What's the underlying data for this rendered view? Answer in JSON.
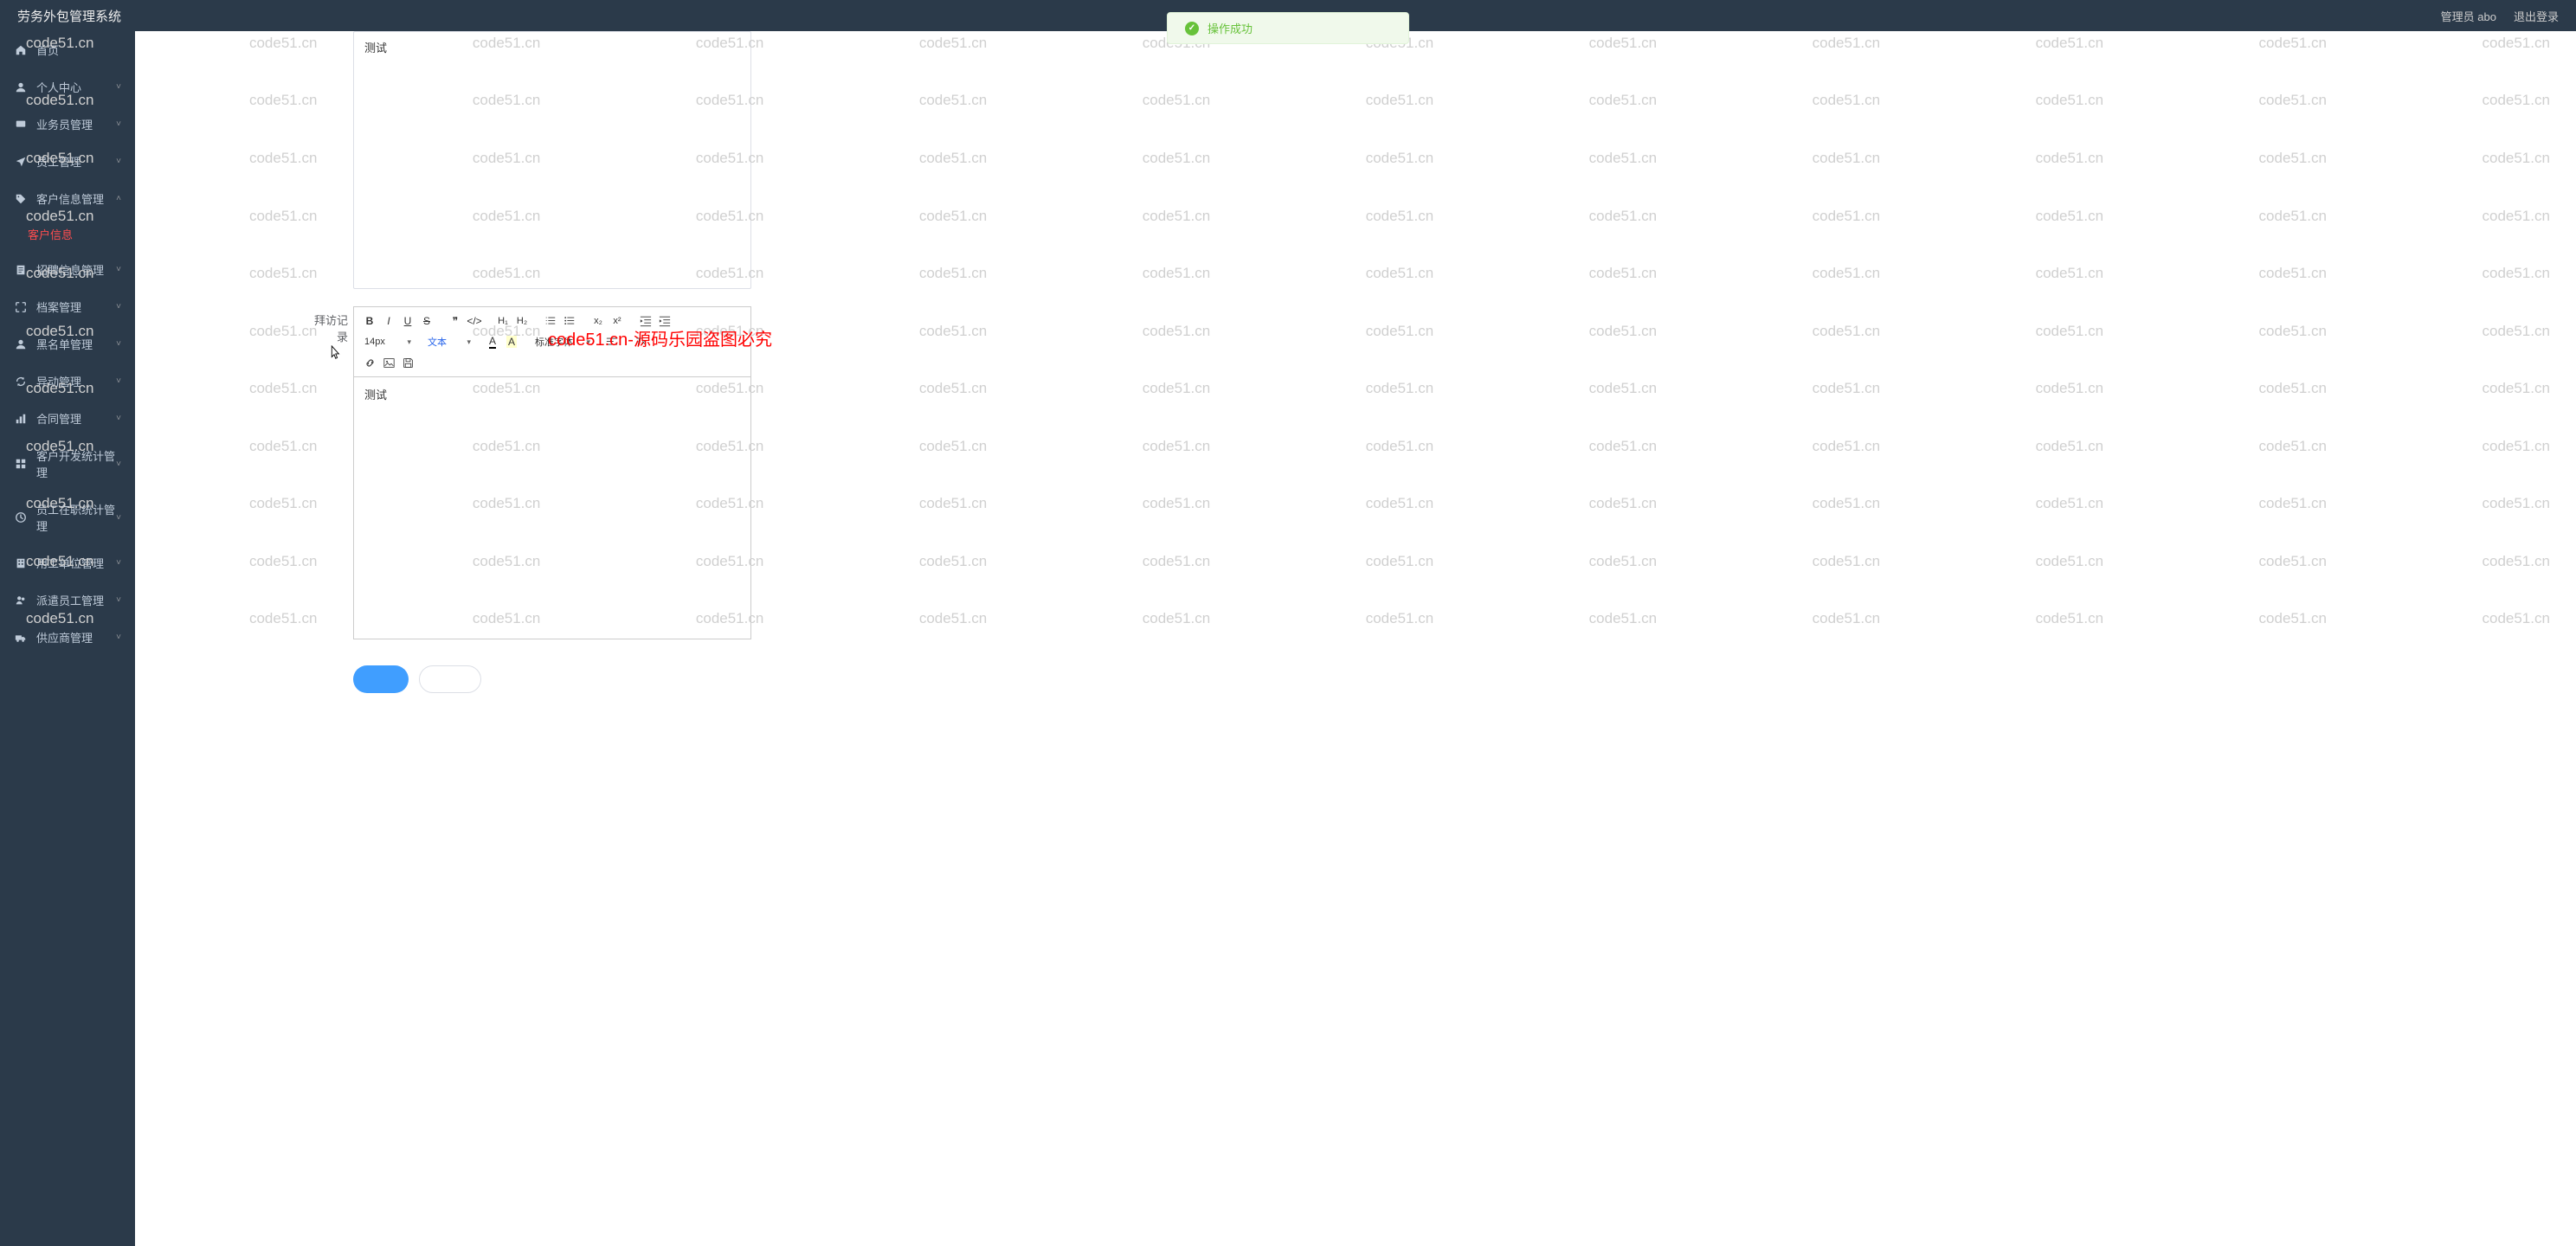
{
  "header": {
    "title": "劳务外包管理系统",
    "admin_label": "管理员 abo",
    "logout_label": "退出登录"
  },
  "toast": {
    "message": "操作成功"
  },
  "sidebar": {
    "items": [
      {
        "icon": "home",
        "label": "首页",
        "expandable": false
      },
      {
        "icon": "user",
        "label": "个人中心",
        "expandable": true
      },
      {
        "icon": "monitor",
        "label": "业务员管理",
        "expandable": true
      },
      {
        "icon": "plane",
        "label": "员工管理",
        "expandable": true
      },
      {
        "icon": "tag",
        "label": "客户信息管理",
        "expandable": true,
        "expanded": true,
        "children": [
          {
            "label": "客户信息",
            "active": true
          }
        ]
      },
      {
        "icon": "doc",
        "label": "招聘信息管理",
        "expandable": true
      },
      {
        "icon": "expand",
        "label": "档案管理",
        "expandable": true
      },
      {
        "icon": "user",
        "label": "黑名单管理",
        "expandable": true
      },
      {
        "icon": "refresh",
        "label": "异动管理",
        "expandable": true
      },
      {
        "icon": "chart",
        "label": "合同管理",
        "expandable": true
      },
      {
        "icon": "grid",
        "label": "客户开发统计管理",
        "expandable": true
      },
      {
        "icon": "clock",
        "label": "员工在职统计管理",
        "expandable": true
      },
      {
        "icon": "building",
        "label": "用工单位管理",
        "expandable": true
      },
      {
        "icon": "users",
        "label": "派遣员工管理",
        "expandable": true
      },
      {
        "icon": "truck",
        "label": "供应商管理",
        "expandable": true
      }
    ]
  },
  "form": {
    "editor1": {
      "content": "测试"
    },
    "editor2": {
      "label": "拜访记录",
      "content": "测试",
      "toolbar": {
        "font_size": "14px",
        "text_label": "文本",
        "font_family": "标准字体"
      }
    }
  },
  "watermark": {
    "text": "code51.cn",
    "center": "code51.cn-源码乐园盗图必究"
  }
}
